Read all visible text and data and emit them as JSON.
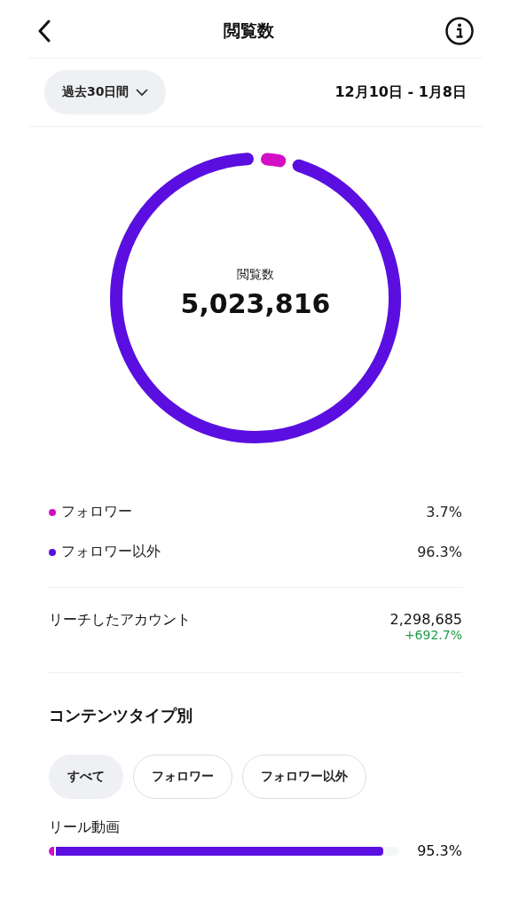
{
  "header": {
    "title": "閲覧数"
  },
  "filter": {
    "period": "過去30日間",
    "range": "12月10日 - 1月8日"
  },
  "total": {
    "label": "閲覧数",
    "value": "5,023,816"
  },
  "breakdown": [
    {
      "label": "フォロワー",
      "value": "3.7%",
      "color": "#d20fc7"
    },
    {
      "label": "フォロワー以外",
      "value": "96.3%",
      "color": "#5a0fe0"
    }
  ],
  "reach": {
    "label": "リーチしたアカウント",
    "value": "2,298,685",
    "change": "+692.7%"
  },
  "content_type": {
    "title": "コンテンツタイプ別",
    "chips": [
      {
        "label": "すべて",
        "selected": true
      },
      {
        "label": "フォロワー",
        "selected": false
      },
      {
        "label": "フォロワー以外",
        "selected": false
      }
    ],
    "rows": [
      {
        "label": "リール動画",
        "value": "95.3%",
        "level": 0.953
      }
    ]
  }
}
